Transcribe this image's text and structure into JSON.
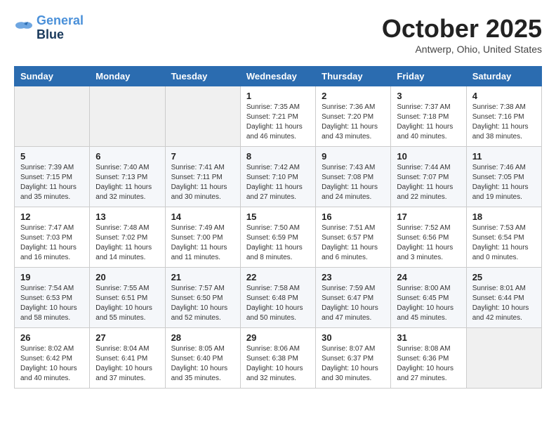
{
  "header": {
    "logo_line1": "General",
    "logo_line2": "Blue",
    "month": "October 2025",
    "location": "Antwerp, Ohio, United States"
  },
  "weekdays": [
    "Sunday",
    "Monday",
    "Tuesday",
    "Wednesday",
    "Thursday",
    "Friday",
    "Saturday"
  ],
  "weeks": [
    [
      {
        "day": "",
        "info": ""
      },
      {
        "day": "",
        "info": ""
      },
      {
        "day": "",
        "info": ""
      },
      {
        "day": "1",
        "info": "Sunrise: 7:35 AM\nSunset: 7:21 PM\nDaylight: 11 hours\nand 46 minutes."
      },
      {
        "day": "2",
        "info": "Sunrise: 7:36 AM\nSunset: 7:20 PM\nDaylight: 11 hours\nand 43 minutes."
      },
      {
        "day": "3",
        "info": "Sunrise: 7:37 AM\nSunset: 7:18 PM\nDaylight: 11 hours\nand 40 minutes."
      },
      {
        "day": "4",
        "info": "Sunrise: 7:38 AM\nSunset: 7:16 PM\nDaylight: 11 hours\nand 38 minutes."
      }
    ],
    [
      {
        "day": "5",
        "info": "Sunrise: 7:39 AM\nSunset: 7:15 PM\nDaylight: 11 hours\nand 35 minutes."
      },
      {
        "day": "6",
        "info": "Sunrise: 7:40 AM\nSunset: 7:13 PM\nDaylight: 11 hours\nand 32 minutes."
      },
      {
        "day": "7",
        "info": "Sunrise: 7:41 AM\nSunset: 7:11 PM\nDaylight: 11 hours\nand 30 minutes."
      },
      {
        "day": "8",
        "info": "Sunrise: 7:42 AM\nSunset: 7:10 PM\nDaylight: 11 hours\nand 27 minutes."
      },
      {
        "day": "9",
        "info": "Sunrise: 7:43 AM\nSunset: 7:08 PM\nDaylight: 11 hours\nand 24 minutes."
      },
      {
        "day": "10",
        "info": "Sunrise: 7:44 AM\nSunset: 7:07 PM\nDaylight: 11 hours\nand 22 minutes."
      },
      {
        "day": "11",
        "info": "Sunrise: 7:46 AM\nSunset: 7:05 PM\nDaylight: 11 hours\nand 19 minutes."
      }
    ],
    [
      {
        "day": "12",
        "info": "Sunrise: 7:47 AM\nSunset: 7:03 PM\nDaylight: 11 hours\nand 16 minutes."
      },
      {
        "day": "13",
        "info": "Sunrise: 7:48 AM\nSunset: 7:02 PM\nDaylight: 11 hours\nand 14 minutes."
      },
      {
        "day": "14",
        "info": "Sunrise: 7:49 AM\nSunset: 7:00 PM\nDaylight: 11 hours\nand 11 minutes."
      },
      {
        "day": "15",
        "info": "Sunrise: 7:50 AM\nSunset: 6:59 PM\nDaylight: 11 hours\nand 8 minutes."
      },
      {
        "day": "16",
        "info": "Sunrise: 7:51 AM\nSunset: 6:57 PM\nDaylight: 11 hours\nand 6 minutes."
      },
      {
        "day": "17",
        "info": "Sunrise: 7:52 AM\nSunset: 6:56 PM\nDaylight: 11 hours\nand 3 minutes."
      },
      {
        "day": "18",
        "info": "Sunrise: 7:53 AM\nSunset: 6:54 PM\nDaylight: 11 hours\nand 0 minutes."
      }
    ],
    [
      {
        "day": "19",
        "info": "Sunrise: 7:54 AM\nSunset: 6:53 PM\nDaylight: 10 hours\nand 58 minutes."
      },
      {
        "day": "20",
        "info": "Sunrise: 7:55 AM\nSunset: 6:51 PM\nDaylight: 10 hours\nand 55 minutes."
      },
      {
        "day": "21",
        "info": "Sunrise: 7:57 AM\nSunset: 6:50 PM\nDaylight: 10 hours\nand 52 minutes."
      },
      {
        "day": "22",
        "info": "Sunrise: 7:58 AM\nSunset: 6:48 PM\nDaylight: 10 hours\nand 50 minutes."
      },
      {
        "day": "23",
        "info": "Sunrise: 7:59 AM\nSunset: 6:47 PM\nDaylight: 10 hours\nand 47 minutes."
      },
      {
        "day": "24",
        "info": "Sunrise: 8:00 AM\nSunset: 6:45 PM\nDaylight: 10 hours\nand 45 minutes."
      },
      {
        "day": "25",
        "info": "Sunrise: 8:01 AM\nSunset: 6:44 PM\nDaylight: 10 hours\nand 42 minutes."
      }
    ],
    [
      {
        "day": "26",
        "info": "Sunrise: 8:02 AM\nSunset: 6:42 PM\nDaylight: 10 hours\nand 40 minutes."
      },
      {
        "day": "27",
        "info": "Sunrise: 8:04 AM\nSunset: 6:41 PM\nDaylight: 10 hours\nand 37 minutes."
      },
      {
        "day": "28",
        "info": "Sunrise: 8:05 AM\nSunset: 6:40 PM\nDaylight: 10 hours\nand 35 minutes."
      },
      {
        "day": "29",
        "info": "Sunrise: 8:06 AM\nSunset: 6:38 PM\nDaylight: 10 hours\nand 32 minutes."
      },
      {
        "day": "30",
        "info": "Sunrise: 8:07 AM\nSunset: 6:37 PM\nDaylight: 10 hours\nand 30 minutes."
      },
      {
        "day": "31",
        "info": "Sunrise: 8:08 AM\nSunset: 6:36 PM\nDaylight: 10 hours\nand 27 minutes."
      },
      {
        "day": "",
        "info": ""
      }
    ]
  ]
}
